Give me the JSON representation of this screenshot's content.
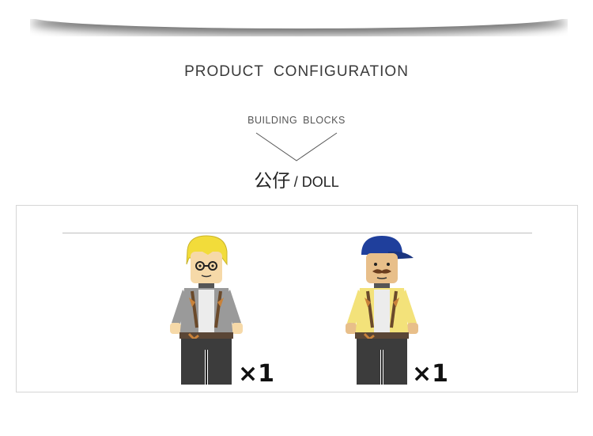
{
  "header": {
    "title": "PRODUCT  CONFIGURATION",
    "subtitle": "BUILDING  BLOCKS",
    "doll_title_cn": "公仔",
    "doll_title_en": "/ DOLL"
  },
  "figures": [
    {
      "quantity": "×1",
      "hair_color": "#f2dc3a",
      "jacket_color": "#9a9a9a",
      "icon": "minifigure-glasses-icon"
    },
    {
      "quantity": "×1",
      "cap_color": "#1f3f9c",
      "jacket_color": "#f3e27a",
      "icon": "minifigure-cap-icon"
    }
  ]
}
